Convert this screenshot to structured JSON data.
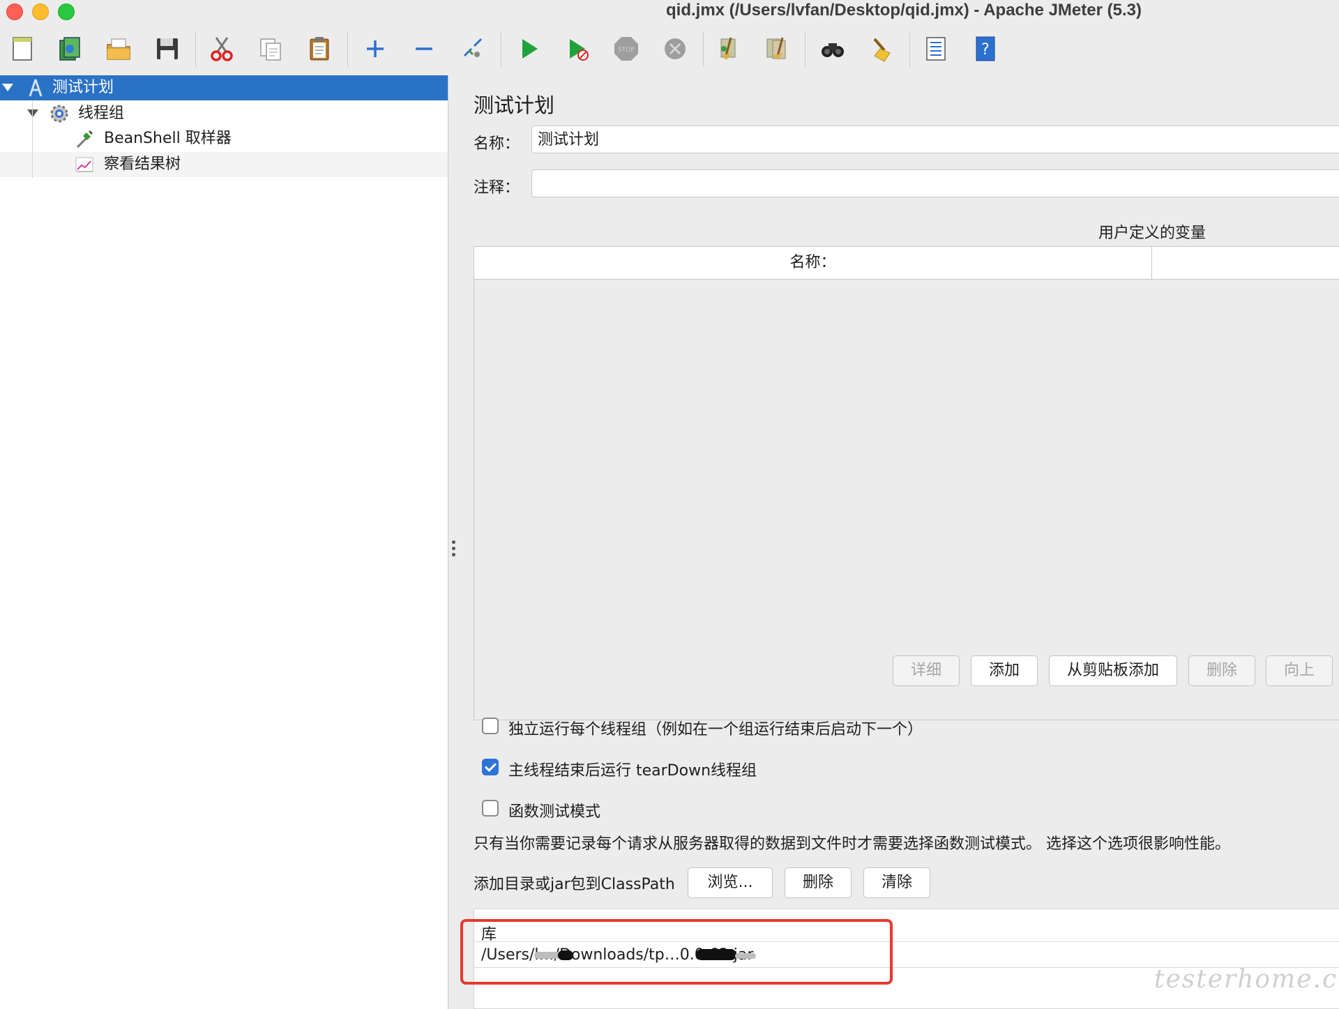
{
  "window": {
    "title": "qid.jmx (/Users/lvfan/Desktop/qid.jmx) - Apache JMeter (5.3)"
  },
  "toolbar": {
    "icons": [
      "new-icon",
      "templates-icon",
      "open-icon",
      "save-icon",
      "cut-icon",
      "copy-icon",
      "paste-icon",
      "expand-icon",
      "collapse-icon",
      "toggle-icon",
      "start-icon",
      "start-no-pause-icon",
      "stop-icon",
      "shutdown-icon",
      "clear-icon",
      "clear-all-icon",
      "search-icon",
      "reset-search-icon",
      "function-helper-icon",
      "help-icon"
    ]
  },
  "tree": {
    "items": [
      {
        "label": "测试计划",
        "icon": "test-plan-icon",
        "selected": true
      },
      {
        "label": "线程组",
        "icon": "thread-group-gear-icon"
      },
      {
        "label": "BeanShell 取样器",
        "icon": "sampler-pipette-icon"
      },
      {
        "label": "察看结果树",
        "icon": "results-tree-chart-icon"
      }
    ]
  },
  "panel": {
    "title": "测试计划",
    "name_label": "名称：",
    "name_value": "测试计划",
    "comment_label": "注释：",
    "comment_value": "",
    "vars_title": "用户定义的变量",
    "vars_col_name": "名称：",
    "buttons": {
      "detail": "详细",
      "add": "添加",
      "add_clipboard": "从剪贴板添加",
      "delete": "删除",
      "up": "向上"
    },
    "checkboxes": [
      {
        "label": "独立运行每个线程组（例如在一个组运行结束后启动下一个）",
        "checked": false
      },
      {
        "label": "主线程结束后运行 tearDown线程组",
        "checked": true
      },
      {
        "label": "函数测试模式",
        "checked": false
      }
    ],
    "note": "只有当你需要记录每个请求从服务器取得的数据到文件时才需要选择函数测试模式。 选择这个选项很影响性能。",
    "classpath_label": "添加目录或jar包到ClassPath",
    "classpath_buttons": {
      "browse": "浏览...",
      "delete": "删除",
      "clear": "清除"
    },
    "lib_header": "库",
    "lib_path": "/Users/l…/Downloads/tp…0.0.63.jar"
  },
  "watermark": "testerhome.com",
  "colors": {
    "selection": "#2a72c6",
    "highlight_box": "#e53a2f",
    "checkbox_on": "#2d74d9"
  }
}
